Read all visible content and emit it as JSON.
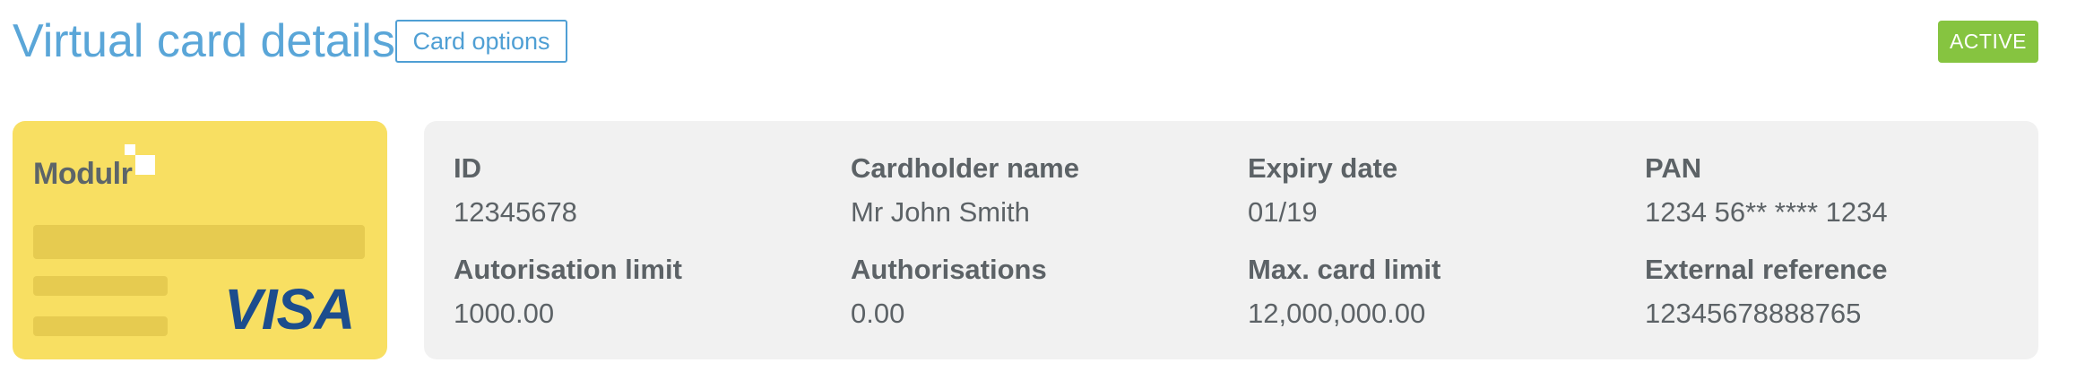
{
  "header": {
    "title": "Virtual card details",
    "card_options_label": "Card options",
    "status": "ACTIVE"
  },
  "card": {
    "brand": "Modulr",
    "network": "VISA"
  },
  "details": {
    "id": {
      "label": "ID",
      "value": "12345678"
    },
    "cardholder_name": {
      "label": "Cardholder name",
      "value": "Mr John Smith"
    },
    "expiry_date": {
      "label": "Expiry date",
      "value": "01/19"
    },
    "pan": {
      "label": "PAN",
      "value": "1234 56** **** 1234"
    },
    "authorisation_limit": {
      "label": "Autorisation limit",
      "value": "1000.00"
    },
    "authorisations": {
      "label": "Authorisations",
      "value": "0.00"
    },
    "max_card_limit": {
      "label": "Max. card limit",
      "value": "12,000,000.00"
    },
    "external_reference": {
      "label": "External reference",
      "value": "12345678888765"
    }
  },
  "colors": {
    "title": "#5aa6d8",
    "button_border": "#4f9fd4",
    "status_badge": "#86c440",
    "card_background": "#f8df62",
    "visa_blue": "#1c4d8d",
    "panel_background": "#f1f1f1",
    "text": "#5c6266"
  }
}
